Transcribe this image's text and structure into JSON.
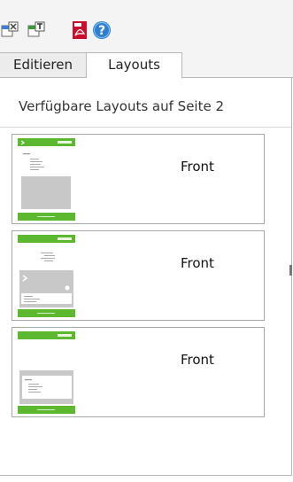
{
  "toolbar": {
    "buttons": [
      {
        "name": "layout-x-icon",
        "color": "#3b7dd8"
      },
      {
        "name": "layout-t-icon",
        "color": "#3a9b3a"
      },
      {
        "name": "pdf-icon",
        "color": "#c8102e"
      },
      {
        "name": "help-icon",
        "color": "#2f7fd0"
      }
    ]
  },
  "tabs": {
    "edit_label": "Editieren",
    "layouts_label": "Layouts",
    "active": "Layouts"
  },
  "panel": {
    "title": "Verfügbare Layouts auf Seite 2",
    "layouts": [
      {
        "label": "Front",
        "variant": "image-bottom"
      },
      {
        "label": "Front",
        "variant": "image-with-panel"
      },
      {
        "label": "Front",
        "variant": "box-bottom"
      }
    ]
  },
  "colors": {
    "green": "#5cb82e",
    "gray_block": "#c8c8c8"
  }
}
